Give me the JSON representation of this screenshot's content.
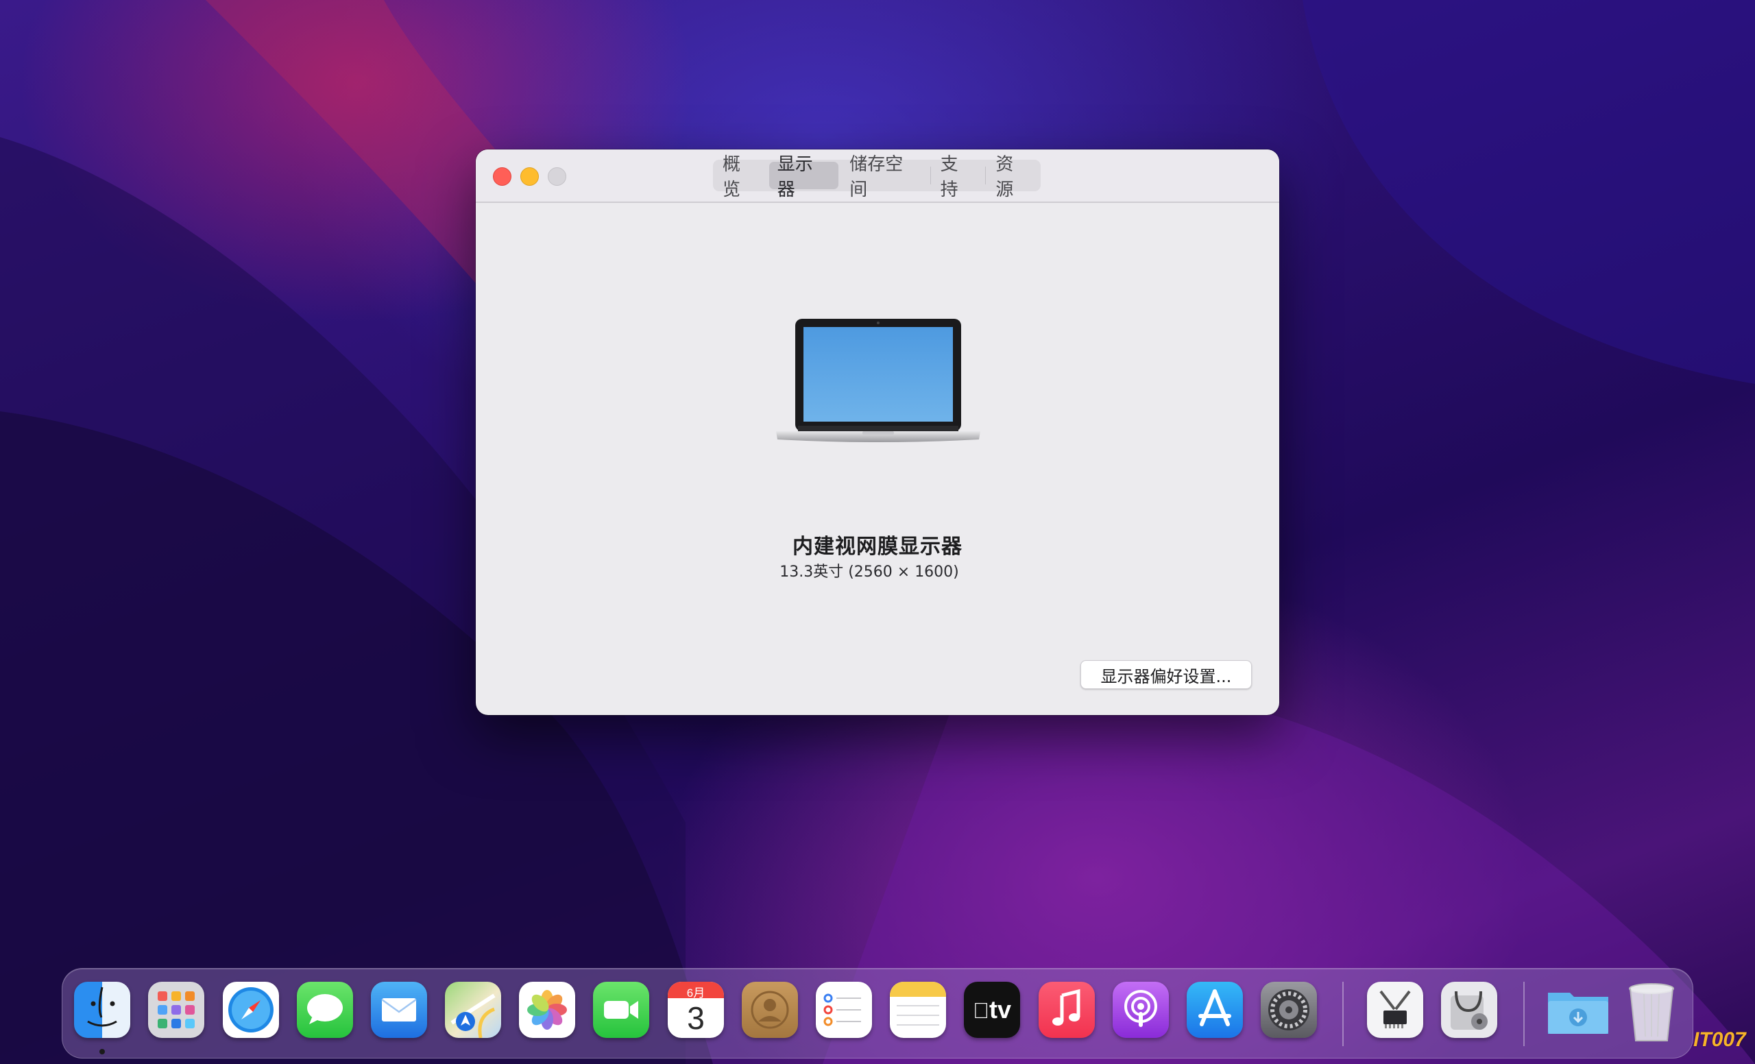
{
  "window": {
    "tabs": [
      {
        "label": "概览",
        "active": false
      },
      {
        "label": "显示器",
        "active": true
      },
      {
        "label": "储存空间",
        "active": false
      },
      {
        "label": "支持",
        "active": false
      },
      {
        "label": "资源",
        "active": false
      }
    ],
    "display": {
      "name": "内建视网膜显示器",
      "detail": "13.3英寸 (2560 × 1600)"
    },
    "prefs_button_label": "显示器偏好设置..."
  },
  "dock": {
    "calendar_month": "6月",
    "calendar_day": "3",
    "tv_label": "tv",
    "apps": [
      "finder",
      "launchpad",
      "safari",
      "messages",
      "mail",
      "maps",
      "photos",
      "facetime",
      "calendar",
      "contacts",
      "reminders",
      "notes",
      "apple-tv",
      "music",
      "podcasts",
      "app-store",
      "system-preferences",
      "system-information",
      "disk-utility",
      "downloads-folder",
      "trash"
    ]
  },
  "watermark": "IT007",
  "colors": {
    "close": "#ff5f57",
    "minimize": "#febc2e",
    "maximize": "#d7d5da",
    "window_bg": "#ecebee",
    "active_tab": "#c4c2c8"
  }
}
